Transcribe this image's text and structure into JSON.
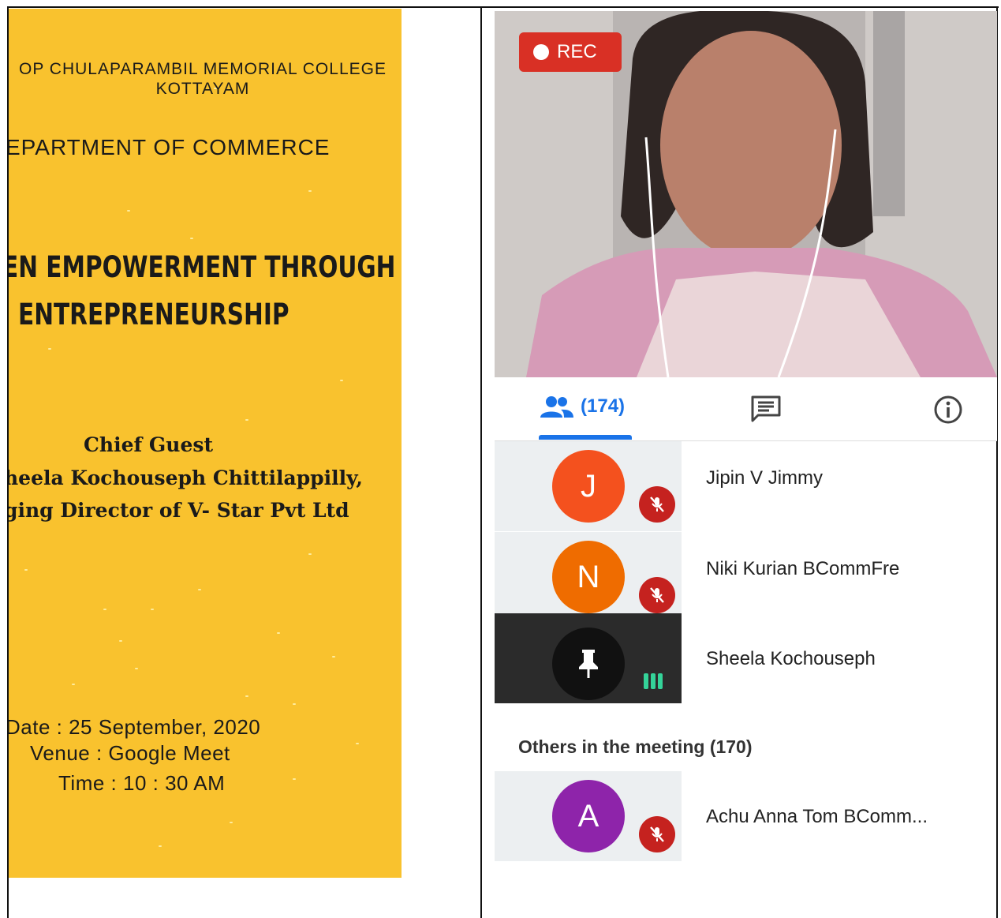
{
  "poster": {
    "college": "OP CHULAPARAMBIL MEMORIAL COLLEGE KOTTAYAM",
    "department": "EPARTMENT OF COMMERCE",
    "title_line1": "EN EMPOWERMENT THROUGH",
    "title_line2": "ENTREPRENEURSHIP",
    "chief_guest_label": "Chief Guest",
    "guest_name": "heela Kochouseph Chittilappilly,",
    "guest_role": "ging Director of V- Star Pvt Ltd",
    "date": "Date : 25 September, 2020",
    "venue": "Venue : Google Meet",
    "time": "Time : 10 : 30 AM"
  },
  "meet": {
    "rec_label": "REC",
    "tabs": {
      "people_count": "(174)",
      "people_icon": "people-icon",
      "chat_icon": "chat-icon",
      "info_icon": "info-icon"
    },
    "participants": [
      {
        "initial": "J",
        "name": "Jipin V Jimmy",
        "avatar_color": "#f4511e",
        "status": "muted"
      },
      {
        "initial": "N",
        "name": "Niki Kurian BCommFre",
        "avatar_color": "#ef6c00",
        "status": "muted"
      },
      {
        "initial": "",
        "name": "Sheela Kochouseph",
        "avatar_color": "#111111",
        "status": "pinned-speaking"
      }
    ],
    "others_label": "Others in the meeting (170)",
    "others": [
      {
        "initial": "A",
        "name": "Achu Anna Tom BComm...",
        "avatar_color": "#8e24aa",
        "status": "muted"
      }
    ],
    "colors": {
      "accent": "#1a73e8",
      "rec_red": "#d93025",
      "mute_red": "#c5221f",
      "poster_yellow": "#f9c22e"
    }
  }
}
